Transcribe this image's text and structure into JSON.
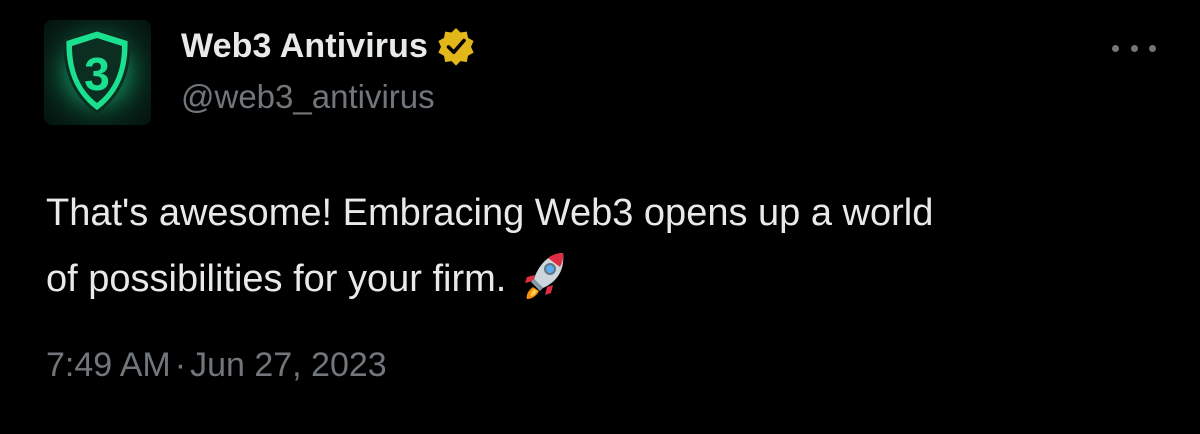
{
  "tweet": {
    "author": {
      "display_name": "Web3 Antivirus",
      "handle": "@web3_antivirus",
      "avatar_glyph": "3",
      "avatar_icon": "shield-3-logo",
      "verified_badge": "verified-gold-badge-icon"
    },
    "text_line1": "That's awesome! Embracing Web3 opens up a world",
    "text_line2": "of possibilities for your firm.",
    "emoji": "rocket-icon",
    "time": "7:49 AM",
    "separator": "·",
    "date": "Jun 27, 2023",
    "more_icon": "more-horizontal-icon"
  },
  "colors": {
    "background": "#000000",
    "primary_text": "#e7e9ea",
    "secondary_text": "#71767b",
    "brand_green": "#19d78a",
    "verified_gold": "#e2b719"
  }
}
